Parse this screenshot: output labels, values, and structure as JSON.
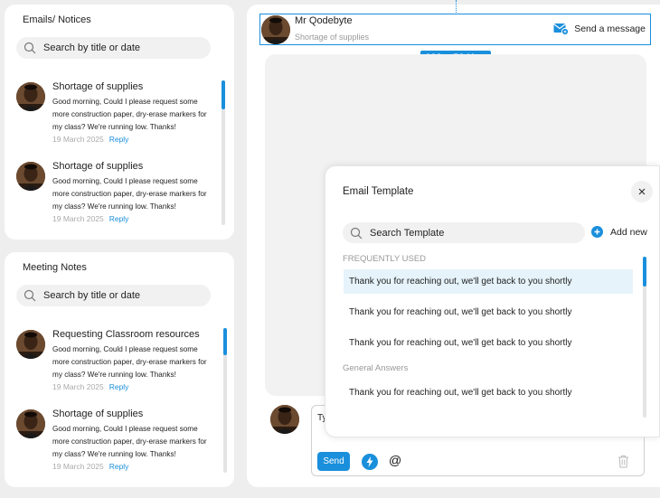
{
  "emails": {
    "title": "Emails/ Notices",
    "search_placeholder": "Search by title or date",
    "items": [
      {
        "title": "Shortage of supplies",
        "body": "Good morning, Could I please request some more construction paper, dry-erase markers for my class? We're running low. Thanks!",
        "date": "19 March 2025",
        "reply": "Reply"
      },
      {
        "title": "Shortage of supplies",
        "body": "Good morning, Could I please request some more construction paper, dry-erase markers for my class? We're running low. Thanks!",
        "date": "19 March 2025",
        "reply": "Reply"
      }
    ]
  },
  "meetings": {
    "title": "Meeting Notes",
    "search_placeholder": "Search by title or date",
    "items": [
      {
        "title": "Requesting Classroom resources",
        "body": "Good morning, Could I please request some more construction paper, dry-erase markers for my class? We're running low. Thanks!",
        "date": "19 March 2025",
        "reply": "Reply"
      },
      {
        "title": "Shortage of supplies",
        "body": "Good morning, Could I please request some more construction paper, dry-erase markers for my class? We're running low. Thanks!",
        "date": "19 March 2025",
        "reply": "Reply"
      }
    ]
  },
  "conversation": {
    "sender_name": "Mr Qodebyte",
    "subject": "Shortage of supplies",
    "send_message_label": "Send a message",
    "dimension_tag": "682 × 52 Hug"
  },
  "composer": {
    "placeholder_visible": "Ty",
    "send_label": "Send",
    "at_symbol": "@"
  },
  "template_modal": {
    "title": "Email Template",
    "search_placeholder": "Search Template",
    "add_new_label": "Add new",
    "section_frequent": "FREQUENTLY USED",
    "frequent_items": [
      "Thank you for reaching out, we'll get back to you shortly",
      "Thank you for reaching out, we'll get back to you shortly",
      "Thank you for reaching out, we'll get back to you shortly"
    ],
    "section_general": "General Answers",
    "general_items": [
      "Thank you for reaching out, we'll get back to you shortly"
    ]
  },
  "colors": {
    "accent": "#1a8fdc",
    "background": "#eeeeee",
    "selected_row": "#e6f3fb"
  }
}
